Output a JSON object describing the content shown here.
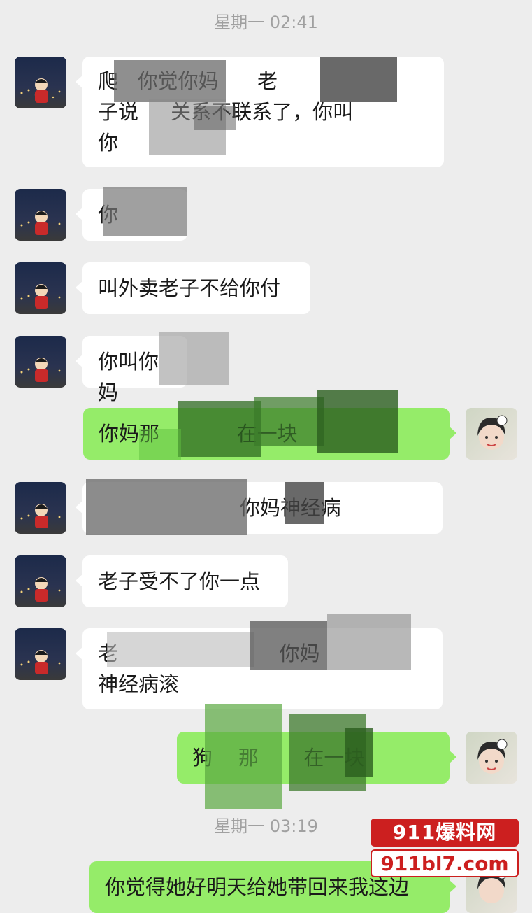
{
  "timestamps": [
    "星期一 02:41",
    "星期一 03:19"
  ],
  "messages": [
    {
      "side": "in",
      "text": "爬   你觉你妈      老\n子说     关系不联系了，你叫\n你"
    },
    {
      "side": "in",
      "text": "你"
    },
    {
      "side": "in",
      "text": "叫外卖老子不给你付"
    },
    {
      "side": "in",
      "text": "你叫你妈"
    },
    {
      "side": "out",
      "text": "你妈那            在一块"
    },
    {
      "side": "in",
      "text": "                      你妈神经病"
    },
    {
      "side": "in",
      "text": "老子受不了你一点"
    },
    {
      "side": "in",
      "text": "老                         你妈\n神经病滚"
    },
    {
      "side": "out",
      "text": "狗    那       在一块"
    },
    {
      "side": "out",
      "text": "你觉得她好明天给她带回来我这边"
    }
  ],
  "watermark": {
    "brand": "911爆料网",
    "site": "911bl7.com"
  },
  "colors": {
    "background": "#ededed",
    "incoming": "#ffffff",
    "outgoing": "#95ec69",
    "watermark": "#cc1f1f"
  }
}
